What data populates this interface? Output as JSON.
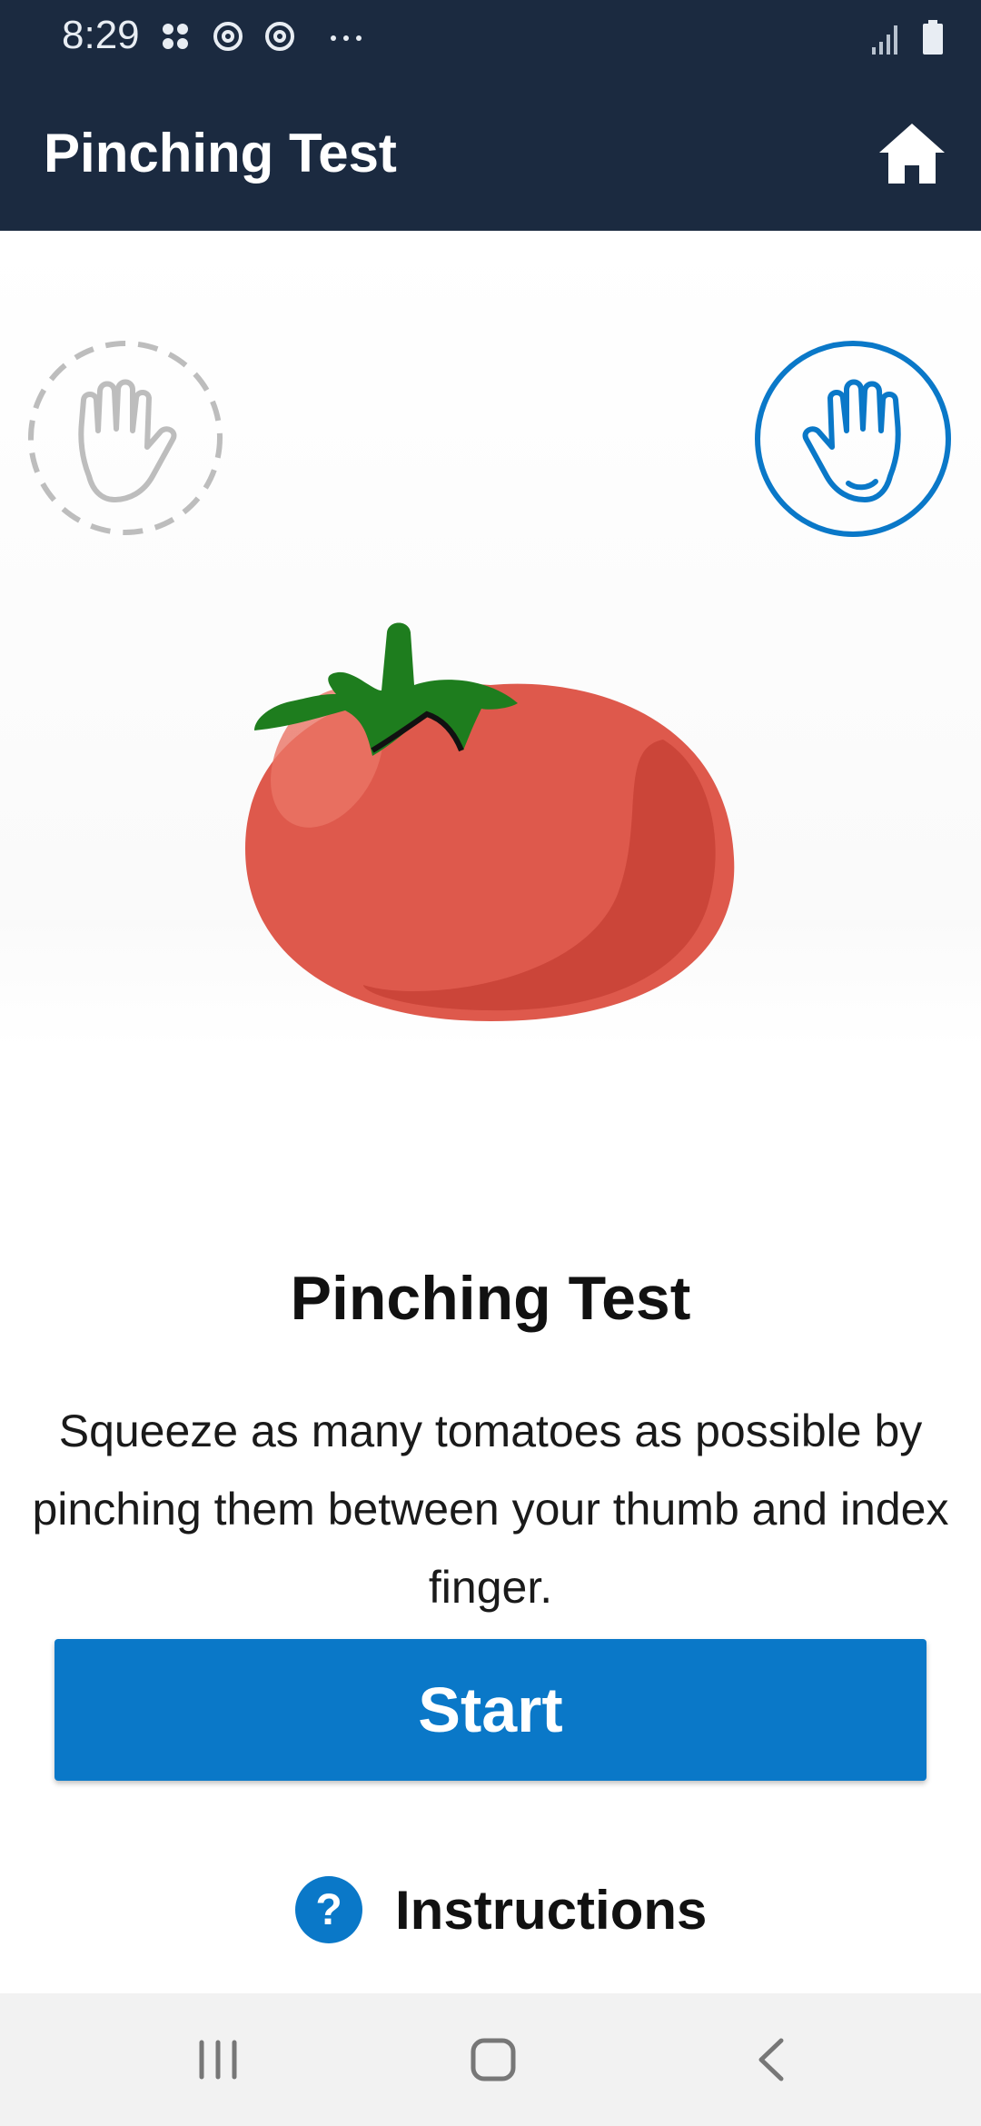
{
  "status_bar": {
    "time": "8:29",
    "icons": [
      "apps-grid-icon",
      "sync-icon",
      "sync-icon",
      "more-dots-icon",
      "signal-icon",
      "battery-icon"
    ]
  },
  "app_bar": {
    "title": "Pinching Test",
    "home_icon": "home-icon"
  },
  "hands": {
    "left": "left-hand-icon",
    "right": "right-hand-icon",
    "selected": "right"
  },
  "main": {
    "heading": "Pinching Test",
    "description": "Squeeze as many tomatoes as possible by pinching them between your thumb and index finger.",
    "start_label": "Start",
    "instructions_label": "Instructions",
    "instructions_icon_glyph": "?"
  },
  "nav_bar": {
    "buttons": [
      "recent-apps-icon",
      "home-circle-icon",
      "back-icon"
    ]
  },
  "colors": {
    "app_bar": "#1b2a40",
    "accent": "#0a78c8",
    "tomato": "#de594c",
    "leaf": "#1e7d1e"
  }
}
